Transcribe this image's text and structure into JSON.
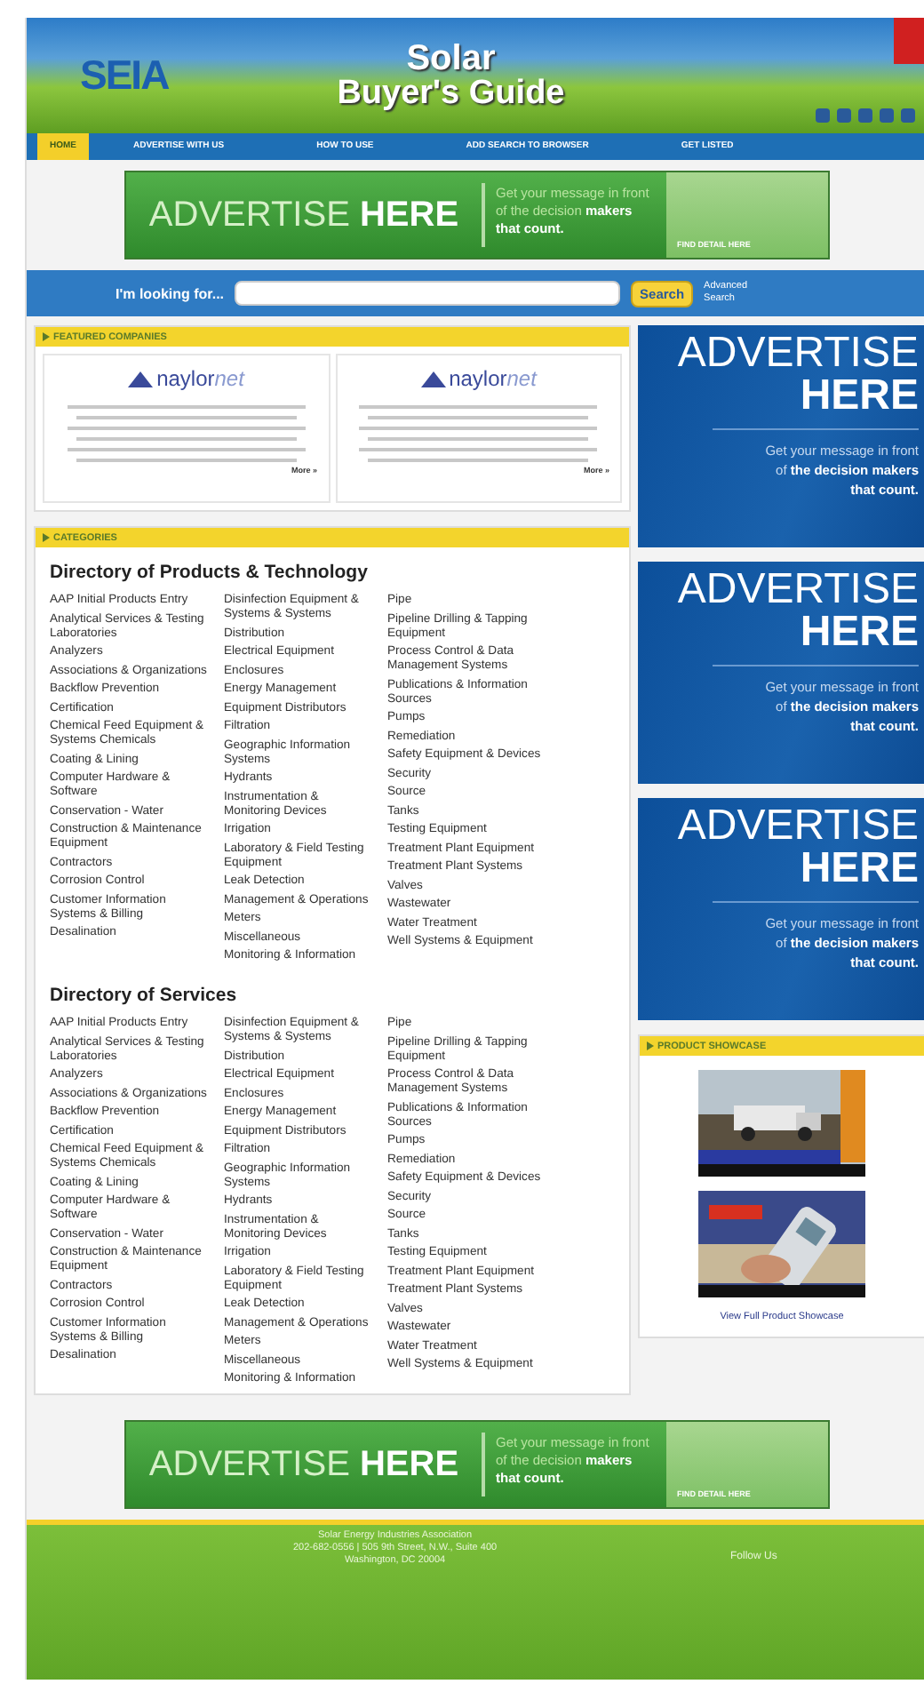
{
  "header": {
    "logo": "SEIA",
    "title": "Solar",
    "subtitle": "Buyer's Guide"
  },
  "nav": [
    {
      "label": "HOME",
      "selected": true
    },
    {
      "label": "ADVERTISE WITH US",
      "selected": false
    },
    {
      "label": "HOW TO USE",
      "selected": false
    },
    {
      "label": "ADD SEARCH TO BROWSER",
      "selected": false
    },
    {
      "label": "GET LISTED",
      "selected": false
    }
  ],
  "banner_top": {
    "headline": "ADVERTISE **HERE**",
    "message": "Get your message in front of the decision **makers that count.**",
    "cta": "FIND DETAIL HERE"
  },
  "search": {
    "label": "I'm looking for...",
    "button": "Search",
    "advanced": "Advanced Search"
  },
  "featured": {
    "heading": "FEATURED COMPANIES",
    "companies": [
      {
        "logo": {
          "name": "naylor",
          "suffix": "net"
        },
        "more": "More »"
      },
      {
        "logo": {
          "name": "naylor",
          "suffix": "net"
        },
        "more": "More »"
      }
    ]
  },
  "categories": {
    "heading": "CATEGORIES",
    "directories": [
      {
        "title": "Directory of Products & Technology",
        "columns": [
          [
            "AAP Initial Products Entry",
            "Analytical Services & Testing Laboratories",
            "Analyzers",
            "Associations & Organizations",
            "Backflow Prevention",
            "Certification",
            "Chemical Feed Equipment & Systems Chemicals",
            "Coating & Lining",
            "Computer Hardware & Software",
            "Conservation - Water",
            "Construction & Maintenance Equipment",
            "Contractors",
            "Corrosion Control",
            "Customer Information Systems & Billing",
            "Desalination"
          ],
          [
            "Disinfection Equipment & Systems & Systems",
            "Distribution",
            "Electrical Equipment",
            "Enclosures",
            "Energy Management",
            "Equipment Distributors",
            "Filtration",
            "Geographic Information Systems",
            "Hydrants",
            "Instrumentation & Monitoring Devices",
            "Irrigation",
            "Laboratory & Field Testing Equipment",
            "Leak Detection",
            "Management & Operations",
            "Meters",
            "Miscellaneous",
            "Monitoring & Information"
          ],
          [
            "Pipe",
            "Pipeline Drilling & Tapping Equipment",
            "Process Control & Data Management Systems",
            "Publications & Information Sources",
            "Pumps",
            "Remediation",
            "Safety Equipment & Devices",
            "Security",
            "Source",
            "Tanks",
            "Testing Equipment",
            "Treatment Plant Equipment",
            "Treatment Plant Systems",
            "Valves",
            "Wastewater",
            "Water Treatment",
            "Well Systems & Equipment"
          ]
        ]
      },
      {
        "title": "Directory of Services",
        "columns": [
          [
            "AAP Initial Products Entry",
            "Analytical Services & Testing Laboratories",
            "Analyzers",
            "Associations & Organizations",
            "Backflow Prevention",
            "Certification",
            "Chemical Feed Equipment & Systems Chemicals",
            "Coating & Lining",
            "Computer Hardware & Software",
            "Conservation - Water",
            "Construction & Maintenance Equipment",
            "Contractors",
            "Corrosion Control",
            "Customer Information Systems & Billing",
            "Desalination"
          ],
          [
            "Disinfection Equipment & Systems & Systems",
            "Distribution",
            "Electrical Equipment",
            "Enclosures",
            "Energy Management",
            "Equipment Distributors",
            "Filtration",
            "Geographic Information Systems",
            "Hydrants",
            "Instrumentation & Monitoring Devices",
            "Irrigation",
            "Laboratory & Field Testing Equipment",
            "Leak Detection",
            "Management & Operations",
            "Meters",
            "Miscellaneous",
            "Monitoring & Information"
          ],
          [
            "Pipe",
            "Pipeline Drilling & Tapping Equipment",
            "Process Control & Data Management Systems",
            "Publications & Information Sources",
            "Pumps",
            "Remediation",
            "Safety Equipment & Devices",
            "Security",
            "Source",
            "Tanks",
            "Testing Equipment",
            "Treatment Plant Equipment",
            "Treatment Plant Systems",
            "Valves",
            "Wastewater",
            "Water Treatment",
            "Well Systems & Equipment"
          ]
        ]
      }
    ]
  },
  "side_ads": [
    {
      "headline": "ADVERTISE **HERE**",
      "message": "Get your message in front of **the decision makers that count.**"
    },
    {
      "headline": "ADVERTISE **HERE**",
      "message": "Get your message in front of **the decision makers that count.**"
    },
    {
      "headline": "ADVERTISE **HERE**",
      "message": "Get your message in front of **the decision makers that count.**"
    }
  ],
  "showcase": {
    "heading": "PRODUCT SHOWCASE",
    "link": "View Full Product Showcase"
  },
  "banner_bottom": {
    "headline": "ADVERTISE **HERE**",
    "message": "Get your message in front of the decision **makers that count.**",
    "cta": "FIND DETAIL HERE"
  },
  "footer": {
    "lines": [
      "Solar Energy Industries Association",
      "202-682-0556 | 505 9th Street, N.W., Suite 400",
      "Washington, DC 20004"
    ],
    "follow": "Follow Us"
  }
}
